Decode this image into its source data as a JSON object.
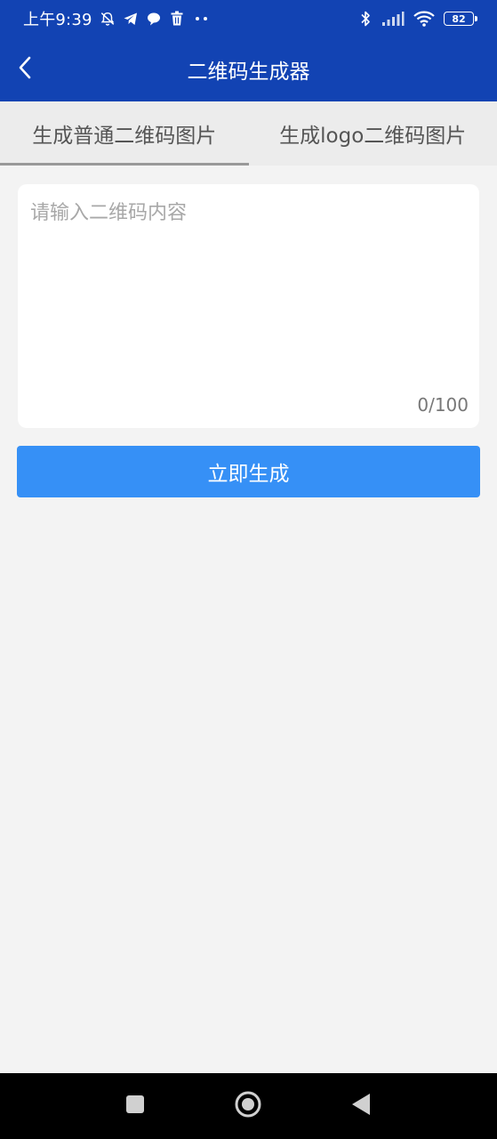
{
  "status_bar": {
    "time": "上午9:39",
    "left_icons": [
      "bell-off-icon",
      "telegram-icon",
      "chat-bubble-icon",
      "trash-icon",
      "more-dots-icon"
    ],
    "right_icons": [
      "bluetooth-icon",
      "signal-icon",
      "wifi-icon",
      "battery-icon"
    ],
    "battery_level": "82"
  },
  "app_bar": {
    "title": "二维码生成器",
    "back_icon": "back-arrow-icon"
  },
  "tabs": [
    {
      "label": "生成普通二维码图片",
      "active": true
    },
    {
      "label": "生成logo二维码图片",
      "active": false
    }
  ],
  "input": {
    "placeholder": "请输入二维码内容",
    "value": "",
    "counter": "0/100"
  },
  "generate_button": {
    "label": "立即生成"
  },
  "nav_bar": {
    "icons": [
      "recents-square-icon",
      "home-circle-icon",
      "back-triangle-icon"
    ]
  },
  "colors": {
    "header": "#1243b3",
    "button": "#3690f6",
    "background": "#f3f3f3",
    "tab_background": "#ececec"
  }
}
